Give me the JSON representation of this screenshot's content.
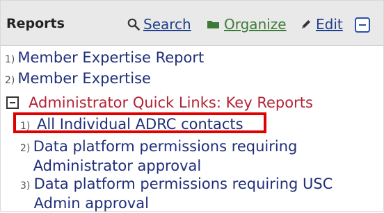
{
  "header": {
    "title": "Reports",
    "search_label": "Search",
    "organize_label": "Organize",
    "edit_label": "Edit"
  },
  "reports": [
    {
      "num": "1)",
      "label": "Member Expertise Report"
    },
    {
      "num": "2)",
      "label": "Member Expertise"
    }
  ],
  "section": {
    "label": "Administrator Quick Links: Key Reports",
    "items": [
      {
        "num": "1)",
        "label": "All Individual ADRC contacts"
      },
      {
        "num": "2)",
        "label": "Data platform permissions requiring Administrator approval"
      },
      {
        "num": "3)",
        "label": "Data platform permissions requiring USC Admin approval"
      }
    ]
  },
  "colors": {
    "link": "#1f2e7a",
    "section_heading": "#b22234",
    "highlight": "#e00000",
    "organize": "#3d7a38"
  }
}
